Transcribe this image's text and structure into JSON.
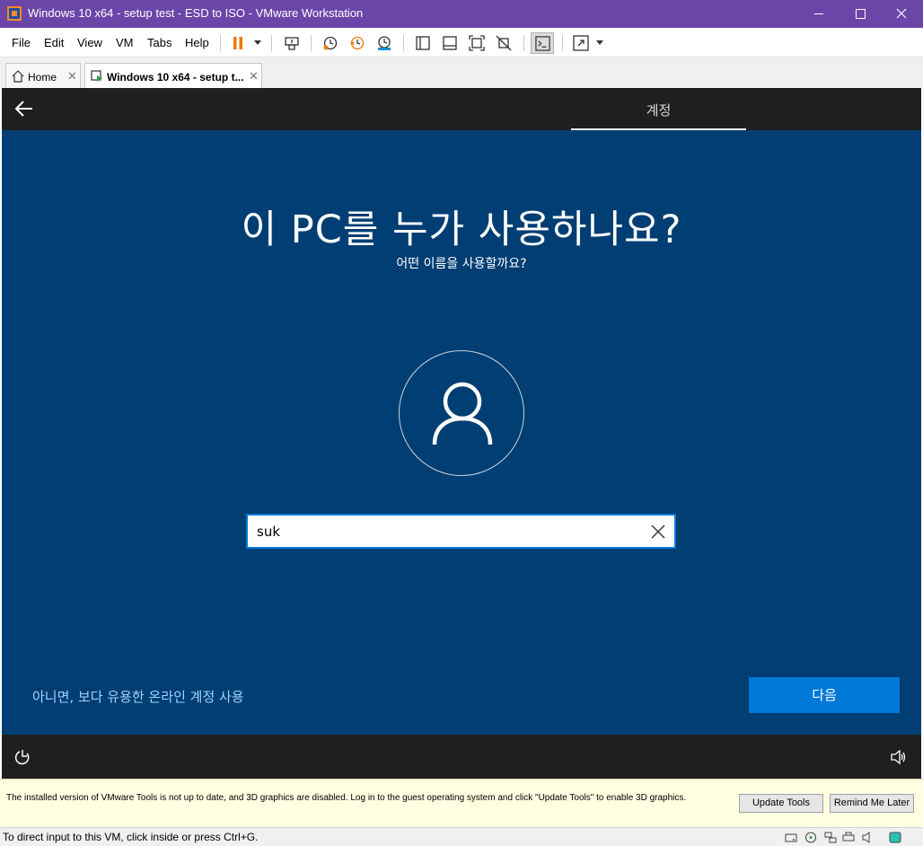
{
  "window": {
    "title": "Windows 10 x64 - setup test - ESD to ISO - VMware Workstation"
  },
  "menu": [
    "File",
    "Edit",
    "View",
    "VM",
    "Tabs",
    "Help"
  ],
  "tabs": [
    {
      "label": "Home"
    },
    {
      "label": "Windows 10 x64 - setup t..."
    }
  ],
  "vm": {
    "header_tab": "계정",
    "title": "이 PC를 누가 사용하나요?",
    "subtitle": "어떤 이름을 사용할까요?",
    "name_value": "suk",
    "alt_link": "아니면, 보다 유용한 온라인 계정 사용",
    "next_label": "다음"
  },
  "notification": {
    "text": "The installed version of VMware Tools is not up to date, and 3D graphics are disabled. Log in to the guest operating system and click \"Update Tools\" to enable 3D graphics.",
    "update_label": "Update Tools",
    "remind_label": "Remind Me Later"
  },
  "status": {
    "text": "To direct input to this VM, click inside or press Ctrl+G."
  },
  "colors": {
    "titlebar": "#6b46a8",
    "oobe_background": "#003e73",
    "accent": "#0078d7",
    "link": "#9fd3ff"
  }
}
